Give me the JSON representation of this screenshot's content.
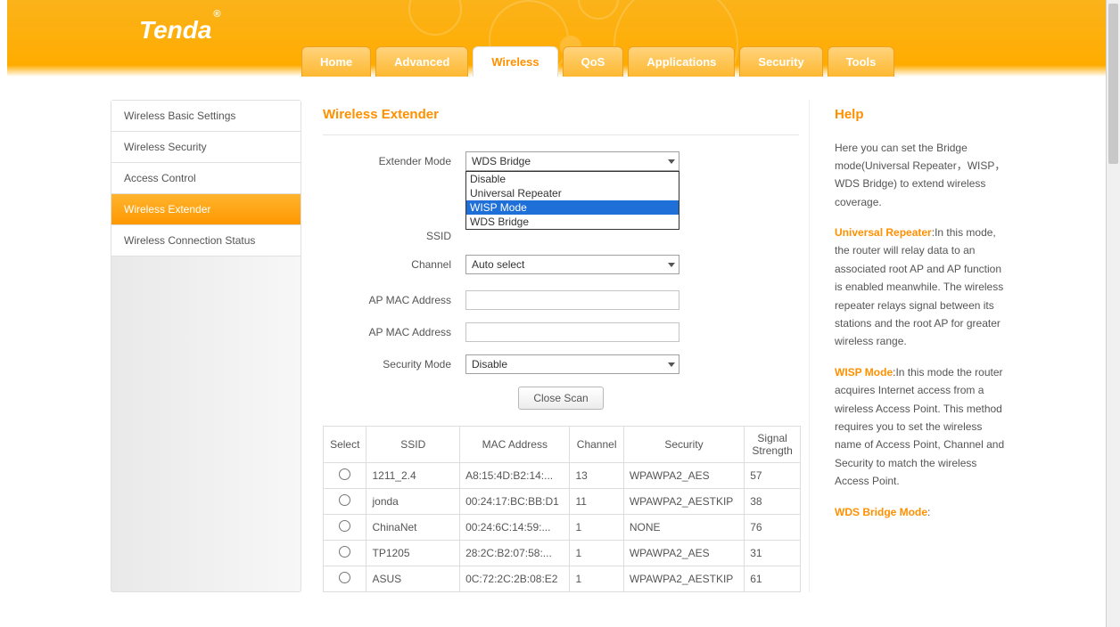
{
  "brand": "Tenda",
  "tabs": [
    {
      "label": "Home"
    },
    {
      "label": "Advanced"
    },
    {
      "label": "Wireless",
      "active": true
    },
    {
      "label": "QoS"
    },
    {
      "label": "Applications"
    },
    {
      "label": "Security"
    },
    {
      "label": "Tools"
    }
  ],
  "sidebar": [
    {
      "label": "Wireless Basic Settings"
    },
    {
      "label": "Wireless Security"
    },
    {
      "label": "Access Control"
    },
    {
      "label": "Wireless Extender",
      "active": true
    },
    {
      "label": "Wireless Connection Status"
    }
  ],
  "page_title": "Wireless Extender",
  "form": {
    "extender_mode": {
      "label": "Extender Mode",
      "value": "WDS Bridge",
      "options": [
        "Disable",
        "Universal Repeater",
        "WISP Mode",
        "WDS Bridge"
      ],
      "highlighted_index": 2
    },
    "ssid": {
      "label": "SSID",
      "value": ""
    },
    "channel": {
      "label": "Channel",
      "value": "Auto select"
    },
    "ap_mac_1": {
      "label": "AP MAC Address",
      "value": ""
    },
    "ap_mac_2": {
      "label": "AP MAC Address",
      "value": ""
    },
    "security_mode": {
      "label": "Security Mode",
      "value": "Disable"
    }
  },
  "close_scan_label": "Close Scan",
  "scan_table": {
    "headers": [
      "Select",
      "SSID",
      "MAC Address",
      "Channel",
      "Security",
      "Signal Strength"
    ],
    "rows": [
      {
        "ssid": "1211_2.4",
        "mac": "A8:15:4D:B2:14:...",
        "channel": "13",
        "security": "WPAWPA2_AES",
        "signal": "57"
      },
      {
        "ssid": "jonda",
        "mac": "00:24:17:BC:BB:D1",
        "channel": "11",
        "security": "WPAWPA2_AESTKIP",
        "signal": "38"
      },
      {
        "ssid": "ChinaNet",
        "mac": "00:24:6C:14:59:...",
        "channel": "1",
        "security": "NONE",
        "signal": "76"
      },
      {
        "ssid": "TP1205",
        "mac": "28:2C:B2:07:58:...",
        "channel": "1",
        "security": "WPAWPA2_AES",
        "signal": "31"
      },
      {
        "ssid": "ASUS",
        "mac": "0C:72:2C:2B:08:E2",
        "channel": "1",
        "security": "WPAWPA2_AESTKIP",
        "signal": "61"
      }
    ]
  },
  "help": {
    "title": "Help",
    "intro": "Here you can set the Bridge mode(Universal Repeater，WISP，WDS Bridge) to extend wireless coverage.",
    "universal_repeater_label": "Universal Repeater",
    "universal_repeater_text": ":In this mode, the router will relay data to an associated root AP and AP function is enabled meanwhile. The wireless repeater relays signal between its stations and the root AP for greater wireless range.",
    "wisp_label": "WISP Mode",
    "wisp_text": ":In this mode the router acquires Internet access from a wireless Access Point. This method requires you to set the wireless name of Access Point, Channel and Security to match the wireless Access Point.",
    "wds_label": "WDS Bridge Mode",
    "wds_colon": ":"
  }
}
